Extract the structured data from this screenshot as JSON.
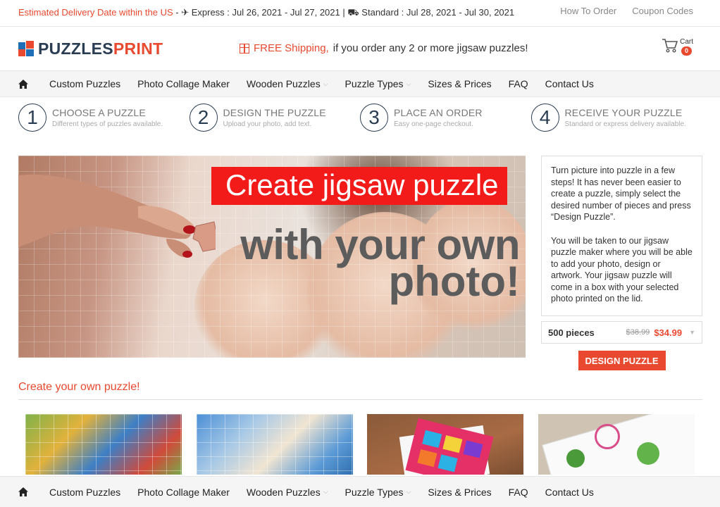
{
  "topbar": {
    "delivery_label": "Estimated Delivery Date within the US",
    "express": "- ✈ Express : Jul 26, 2021 - Jul 27, 2021 | ⛟ Standard : Jul 28, 2021 - Jul 30, 2021",
    "links": [
      "How To Order",
      "Coupon Codes"
    ]
  },
  "header": {
    "logo_part1": "PUZZLES",
    "logo_part2": "PRINT",
    "shipping_accent": "FREE Shipping,",
    "shipping_rest": "if you order any 2 or more jigsaw puzzles!",
    "cart_label": "Cart",
    "cart_count": "0"
  },
  "nav": {
    "items": [
      "Custom Puzzles",
      "Photo Collage Maker",
      "Wooden Puzzles",
      "Puzzle Types",
      "Sizes & Prices",
      "FAQ",
      "Contact Us"
    ]
  },
  "steps": [
    {
      "num": "1",
      "title": "CHOOSE A PUZZLE",
      "desc": "Different types of puzzles available."
    },
    {
      "num": "2",
      "title": "DESIGN THE PUZZLE",
      "desc": "Upload your photo, add text."
    },
    {
      "num": "3",
      "title": "PLACE AN ORDER",
      "desc": "Easy one-page checkout."
    },
    {
      "num": "4",
      "title": "RECEIVE YOUR PUZZLE",
      "desc": "Standard or express delivery available."
    }
  ],
  "hero": {
    "title": "Create jigsaw puzzle",
    "sub1": "with your own",
    "sub2": "photo!"
  },
  "side": {
    "para1": "Turn picture into puzzle in a few steps! It has never been easier to create a puzzle, simply select the desired number of pieces and press “Design Puzzle”.",
    "para2": "You will be taken to our jigsaw puzzle maker where you will be able to add your photo, design or artwork. Your jigsaw puzzle will come in a box with your selected photo printed on the lid.",
    "pieces": "500 pieces",
    "old_price": "$38.99",
    "new_price": "$34.99",
    "button": "DESIGN PUZZLE"
  },
  "section": {
    "title": "Create your own puzzle!"
  },
  "colors": {
    "accent": "#e8492f",
    "hero_title_bg": "#f31a1a",
    "navy": "#2a3d52"
  }
}
